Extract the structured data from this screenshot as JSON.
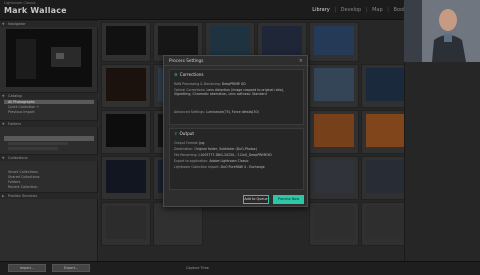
{
  "app": {
    "brand": "Lightroom Classic",
    "identity_plate": "Mark Wallace",
    "modules": [
      "Library",
      "Develop",
      "Map",
      "Book"
    ],
    "active_module": "Library"
  },
  "left_panel": {
    "navigator_label": "Navigator",
    "catalog_label": "Catalog",
    "catalog_items": [
      "All Photographs",
      "Quick Collection +",
      "Previous Import"
    ],
    "folders_label": "Folders",
    "collections_label": "Collections",
    "collection_items": [
      "Smart Collections",
      "Shared Collections",
      "Folders",
      "Recent Collection"
    ],
    "publish_label": "Publish Services",
    "import_button": "Import...",
    "export_button": "Export..."
  },
  "bottom": {
    "sort_label": "Capture Time"
  },
  "dialog": {
    "title": "Process Settings",
    "close_icon": "close-icon",
    "corrections": {
      "header": "Corrections",
      "rows": [
        {
          "key": "RAW Processing & Denoising:",
          "value": "DeepPRIME XD"
        },
        {
          "key": "Optical Corrections:",
          "value": "Lens distortion (image cropped to original ratio), Vignetting, Chromatic aberration, Lens softness: Standard"
        },
        {
          "key": "Advanced Settings:",
          "value": "Luminance(75), Force details(30)"
        }
      ]
    },
    "output": {
      "header": "Output",
      "rows": [
        {
          "key": "Output Format:",
          "value": "Jpg"
        },
        {
          "key": "Destination:",
          "value": "Original folder, Subfolder (DxO-Photos)"
        },
        {
          "key": "File Renaming:",
          "value": "L1005777-DNG-20250...7-DxO_DeepPRIMEXD"
        },
        {
          "key": "Export to application:",
          "value": "Adobe Lightroom Classic"
        },
        {
          "key": "Lightroom Collection Import:",
          "value": "DxO PureRAW 4 - Exchange"
        }
      ]
    },
    "add_to_queue": "Add to Queue",
    "process_now": "Process Now"
  },
  "colors": {
    "accent": "#2cc7a7",
    "panel": "#2d2d2d",
    "grid_bg": "#3d3d3d"
  }
}
